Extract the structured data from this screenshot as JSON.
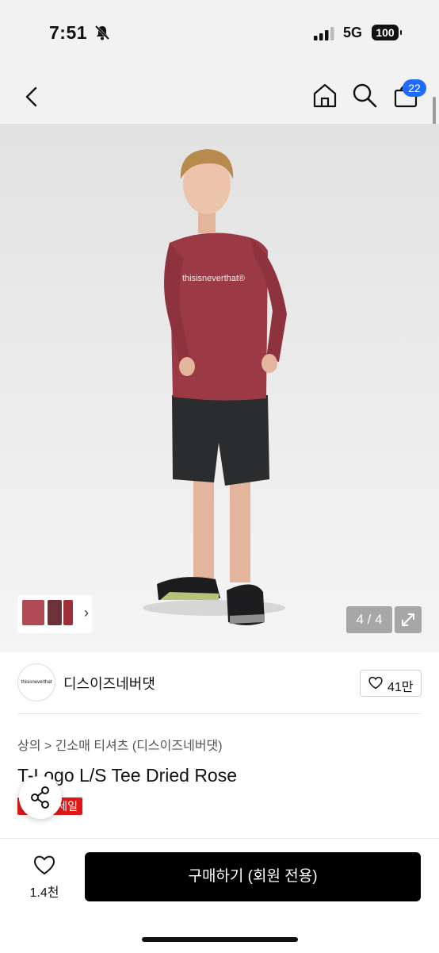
{
  "status_bar": {
    "time": "7:51",
    "network": "5G",
    "battery": "100"
  },
  "header": {
    "cart_count": "22",
    "icons": [
      "back-icon",
      "home-icon",
      "search-icon",
      "cart-icon"
    ]
  },
  "gallery": {
    "page_indicator": "4 / 4",
    "thumbnail_chevron": "›",
    "shirt_text": "thisisneverthat®"
  },
  "brand": {
    "logo_text": "thisisneverthat",
    "name": "디스이즈네버댓",
    "likes": "41만"
  },
  "product": {
    "breadcrumb": "상의 > 긴소매 티셔츠 (디스이즈네버댓)",
    "title": "T-Logo L/S Tee Dried Rose",
    "badge": "세일"
  },
  "bottom_bar": {
    "wish_count": "1.4천",
    "buy_label": "구매하기 (회원 전용)"
  },
  "colors": {
    "accent_blue": "#1f6bff",
    "sale_red": "#e11717",
    "shirt": "#9b3a44",
    "buy_button": "#000000"
  }
}
